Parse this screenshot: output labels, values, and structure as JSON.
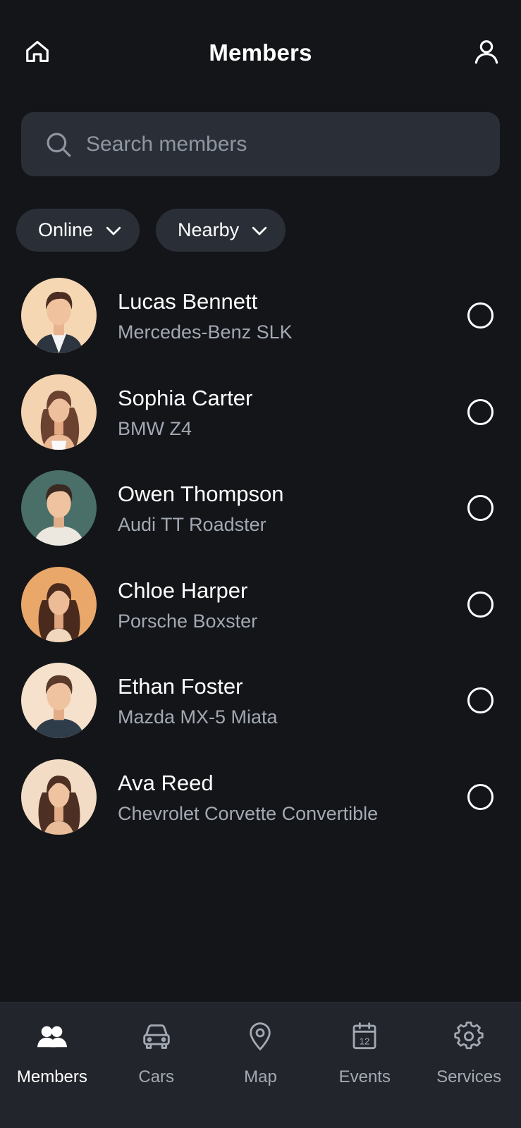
{
  "header": {
    "title": "Members",
    "home_icon": "home-icon",
    "profile_icon": "user-icon"
  },
  "search": {
    "placeholder": "Search members",
    "icon": "search-icon"
  },
  "filters": [
    {
      "label": "Online",
      "icon": "chevron-down-icon"
    },
    {
      "label": "Nearby",
      "icon": "chevron-down-icon"
    }
  ],
  "members": [
    {
      "name": "Lucas Bennett",
      "car": "Mercedes-Benz SLK",
      "selected": false
    },
    {
      "name": "Sophia Carter",
      "car": "BMW Z4",
      "selected": false
    },
    {
      "name": "Owen Thompson",
      "car": "Audi TT Roadster",
      "selected": false
    },
    {
      "name": "Chloe Harper",
      "car": "Porsche Boxster",
      "selected": false
    },
    {
      "name": "Ethan Foster",
      "car": "Mazda MX-5 Miata",
      "selected": false
    },
    {
      "name": "Ava Reed",
      "car": "Chevrolet Corvette Convertible",
      "selected": false
    }
  ],
  "nav": [
    {
      "label": "Members",
      "icon": "members-icon",
      "active": true
    },
    {
      "label": "Cars",
      "icon": "car-icon",
      "active": false
    },
    {
      "label": "Map",
      "icon": "map-pin-icon",
      "active": false
    },
    {
      "label": "Events",
      "icon": "calendar-icon",
      "active": false,
      "badge": "12"
    },
    {
      "label": "Services",
      "icon": "gear-icon",
      "active": false
    }
  ],
  "colors": {
    "background": "#131519",
    "surface": "#2a2f37",
    "nav_background": "#22252b",
    "text_primary": "#ffffff",
    "text_secondary": "#a3a9b3",
    "placeholder": "#8f96a1"
  }
}
